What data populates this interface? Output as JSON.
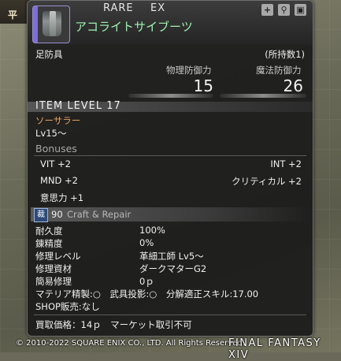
{
  "background": {
    "left_label": "平"
  },
  "header": {
    "rarity_left": "RARE",
    "rarity_right": "EX",
    "item_name": "アコライトサイブーツ",
    "icons": [
      "plus-icon",
      "pin-icon",
      "lock-icon"
    ]
  },
  "category": "足防具",
  "owned_label": "(所持数1)",
  "defense": {
    "physical_label": "物理防御力",
    "magic_label": "魔法防御力",
    "physical_value": "15",
    "magic_value": "26"
  },
  "item_level": "ITEM LEVEL 17",
  "job": {
    "name": "ソーサラー",
    "level": "Lv15～"
  },
  "bonuses": {
    "title": "Bonuses",
    "items": [
      {
        "label": "VIT +2"
      },
      {
        "label": "INT +2"
      },
      {
        "label": "MND +2"
      },
      {
        "label": "クリティカル +2"
      },
      {
        "label": "意思力 +1"
      }
    ]
  },
  "craft": {
    "icon_label": "裁",
    "level": "90",
    "title": "Craft & Repair",
    "rows": [
      {
        "label": "耐久度",
        "value": "100%"
      },
      {
        "label": "錬精度",
        "value": "0%"
      },
      {
        "label": "修理レベル",
        "value": "革細工師 Lv5～"
      },
      {
        "label": "修理資材",
        "value": "ダークマターG2"
      },
      {
        "label": "簡易修理",
        "value": "0ｐ"
      }
    ],
    "materia_line": "マテリア精製:○　武具投影:○　分解適正スキル:17.00",
    "shop_line": "SHOP販売:なし",
    "price_line": "買取価格：14ｐ　マーケット取引不可"
  },
  "footer": {
    "copyright": "© 2010-2022 SQUARE ENIX CO., LTD. All Rights Reserved.",
    "logo": "FINAL FANTASY XIV"
  },
  "colors": {
    "item_name": "#9ef0b0",
    "job": "#e8a060",
    "rarity_marker": "#7c6fd8"
  }
}
